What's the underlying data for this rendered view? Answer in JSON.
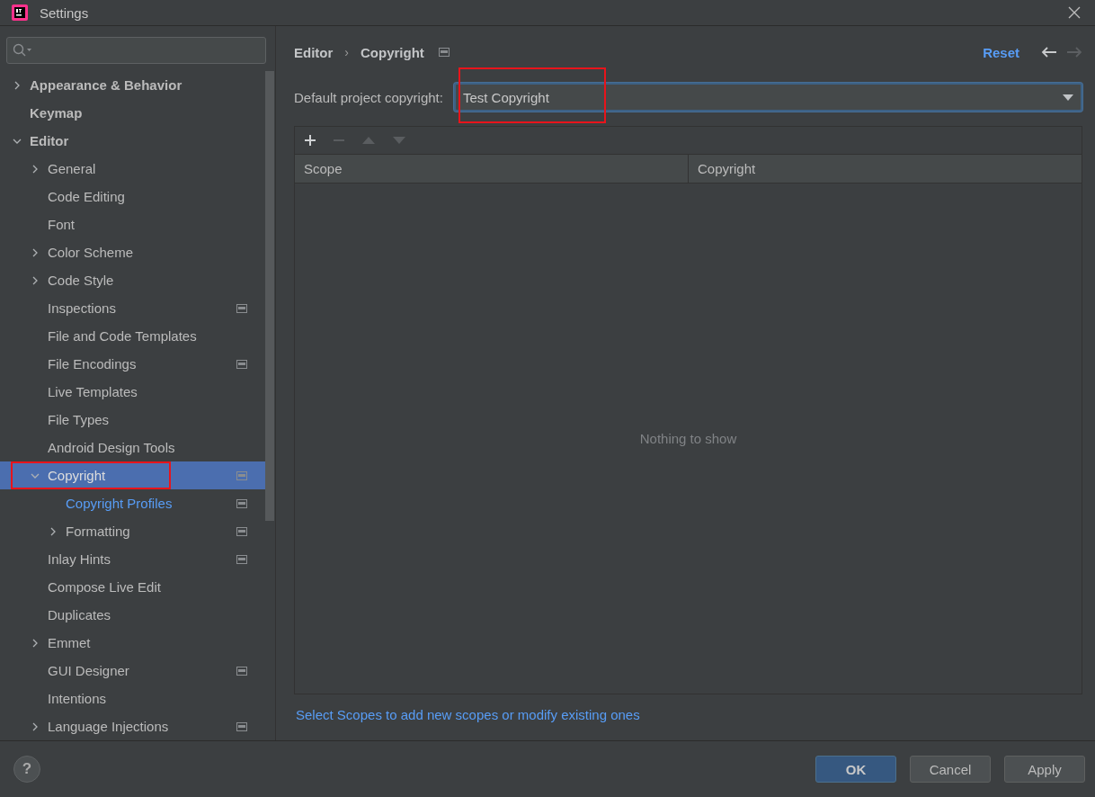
{
  "window": {
    "title": "Settings"
  },
  "sidebar": {
    "items": [
      {
        "label": "Appearance & Behavior",
        "expanded": false,
        "selected": false,
        "modified": false,
        "project_scope": false,
        "annotated": false
      },
      {
        "label": "Keymap",
        "selected": false,
        "modified": false,
        "project_scope": false,
        "annotated": false
      },
      {
        "label": "Editor",
        "expanded": true,
        "selected": false,
        "modified": false,
        "project_scope": false,
        "annotated": false,
        "children": [
          {
            "label": "General",
            "expanded": false,
            "selected": false,
            "modified": false,
            "project_scope": false,
            "annotated": false
          },
          {
            "label": "Code Editing",
            "selected": false,
            "modified": false,
            "project_scope": false,
            "annotated": false
          },
          {
            "label": "Font",
            "selected": false,
            "modified": false,
            "project_scope": false,
            "annotated": false
          },
          {
            "label": "Color Scheme",
            "expanded": false,
            "selected": false,
            "modified": false,
            "project_scope": false,
            "annotated": false
          },
          {
            "label": "Code Style",
            "expanded": false,
            "selected": false,
            "modified": false,
            "project_scope": false,
            "annotated": false
          },
          {
            "label": "Inspections",
            "selected": false,
            "modified": false,
            "project_scope": true,
            "annotated": false
          },
          {
            "label": "File and Code Templates",
            "selected": false,
            "modified": false,
            "project_scope": false,
            "annotated": false
          },
          {
            "label": "File Encodings",
            "selected": false,
            "modified": false,
            "project_scope": true,
            "annotated": false
          },
          {
            "label": "Live Templates",
            "selected": false,
            "modified": false,
            "project_scope": false,
            "annotated": false
          },
          {
            "label": "File Types",
            "selected": false,
            "modified": false,
            "project_scope": false,
            "annotated": false
          },
          {
            "label": "Android Design Tools",
            "selected": false,
            "modified": false,
            "project_scope": false,
            "annotated": false
          },
          {
            "label": "Copyright",
            "expanded": true,
            "selected": true,
            "modified": false,
            "project_scope": true,
            "annotated": true,
            "children": [
              {
                "label": "Copyright Profiles",
                "selected": false,
                "modified": true,
                "project_scope": true,
                "annotated": false
              },
              {
                "label": "Formatting",
                "expanded": false,
                "selected": false,
                "modified": false,
                "project_scope": true,
                "annotated": false
              }
            ]
          },
          {
            "label": "Inlay Hints",
            "selected": false,
            "modified": false,
            "project_scope": true,
            "annotated": false
          },
          {
            "label": "Compose Live Edit",
            "selected": false,
            "modified": false,
            "project_scope": false,
            "annotated": false
          },
          {
            "label": "Duplicates",
            "selected": false,
            "modified": false,
            "project_scope": false,
            "annotated": false
          },
          {
            "label": "Emmet",
            "expanded": false,
            "selected": false,
            "modified": false,
            "project_scope": false,
            "annotated": false
          },
          {
            "label": "GUI Designer",
            "selected": false,
            "modified": false,
            "project_scope": true,
            "annotated": false
          },
          {
            "label": "Intentions",
            "selected": false,
            "modified": false,
            "project_scope": false,
            "annotated": false
          },
          {
            "label": "Language Injections",
            "expanded": false,
            "selected": false,
            "modified": false,
            "project_scope": true,
            "annotated": false
          }
        ]
      }
    ]
  },
  "breadcrumb": [
    "Editor",
    "Copyright"
  ],
  "breadcrumb_separator": "›",
  "help": "?",
  "reset": "Reset",
  "default_copyright": {
    "label": "Default project copyright:",
    "value": "Test Copyright",
    "annotated": true
  },
  "table": {
    "columns": [
      "Scope",
      "Copyright"
    ],
    "empty_text": "Nothing to show"
  },
  "hint_link": "Select Scopes to add new scopes or modify existing ones",
  "buttons": [
    {
      "label": "OK",
      "kind": "primary"
    },
    {
      "label": "Cancel",
      "kind": "normal"
    },
    {
      "label": "Apply",
      "kind": "normal"
    }
  ]
}
